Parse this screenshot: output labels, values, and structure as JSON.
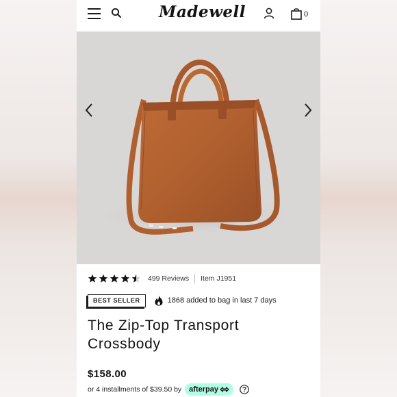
{
  "header": {
    "logo_text": "Madewell",
    "bag_count": "0",
    "icons": [
      "menu-icon",
      "search-icon",
      "account-icon",
      "bag-icon"
    ]
  },
  "gallery": {
    "prev_icon": "chevron-left-icon",
    "next_icon": "chevron-right-icon",
    "background_color": "#d9d6d6",
    "leather_color": "#b0602f"
  },
  "product": {
    "rating_stars": 4.5,
    "reviews": "499 Reviews",
    "item_number": "Item J1951",
    "badge": "BEST SELLER",
    "popularity": "1868 added to bag in last 7 days",
    "title_line1": "The Zip-Top Transport",
    "title_line2": "Crossbody",
    "price": "$158.00",
    "installments": "or 4 installments of $39.50 by",
    "afterpay_label": "afterpay",
    "afterpay_color": "#b2fce4"
  }
}
